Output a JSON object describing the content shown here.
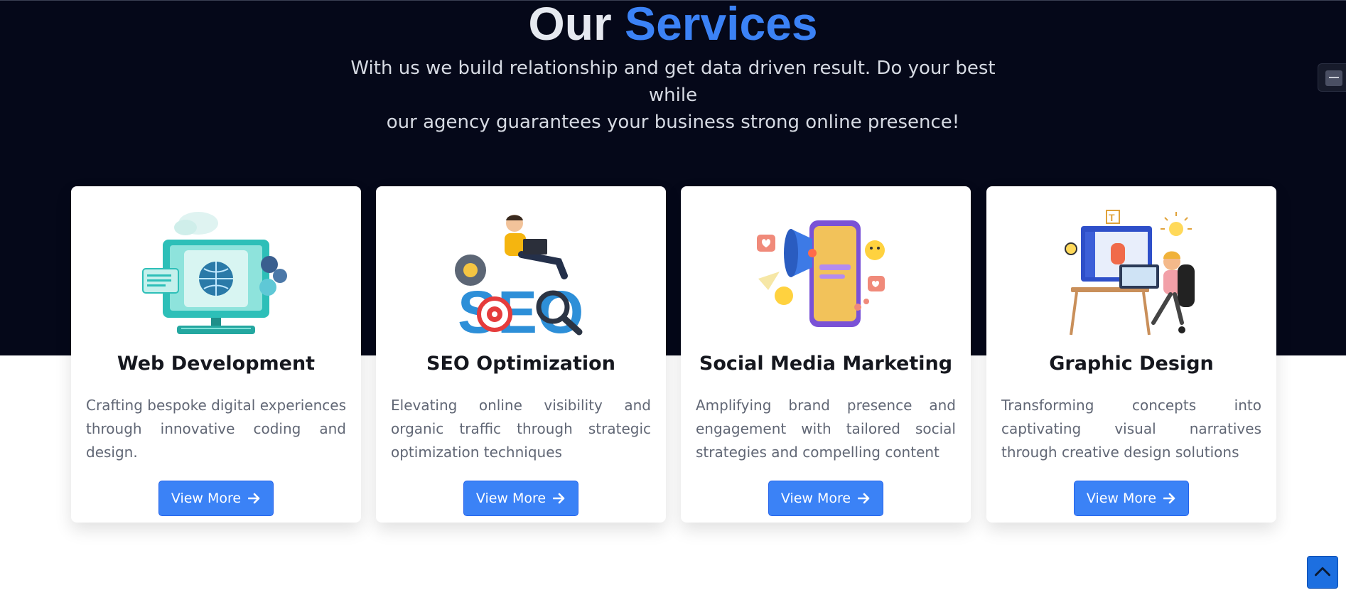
{
  "header": {
    "title_prefix": "Our",
    "title_accent": "Services",
    "subtitle_line1": "With us we build relationship and get data driven result. Do your best while",
    "subtitle_line2": "our agency guarantees your business strong online presence!"
  },
  "colors": {
    "hero_background": "#050819",
    "accent": "#3b82f6",
    "card_background": "#ffffff",
    "text_muted": "#616775"
  },
  "services": [
    {
      "icon": "web-development-illustration",
      "title": "Web Development",
      "description": "Crafting bespoke digital experiences through innovative coding and design.",
      "button_label": "View More",
      "button_icon": "arrow-right-icon"
    },
    {
      "icon": "seo-illustration",
      "title": "SEO Optimization",
      "description": "Elevating online visibility and organic traffic through strategic optimization techniques",
      "button_label": "View More",
      "button_icon": "arrow-right-icon"
    },
    {
      "icon": "social-media-illustration",
      "title": "Social Media Marketing",
      "description": "Amplifying brand presence and engagement with tailored social strategies and compelling content",
      "button_label": "View More",
      "button_icon": "arrow-right-icon"
    },
    {
      "icon": "graphic-design-illustration",
      "title": "Graphic Design",
      "description": "Transforming concepts into captivating visual narratives through creative design solutions",
      "button_label": "View More",
      "button_icon": "arrow-right-icon"
    }
  ],
  "widgets": {
    "side_widget_icon": "side-panel-icon",
    "back_to_top_icon": "chevron-up-icon"
  }
}
